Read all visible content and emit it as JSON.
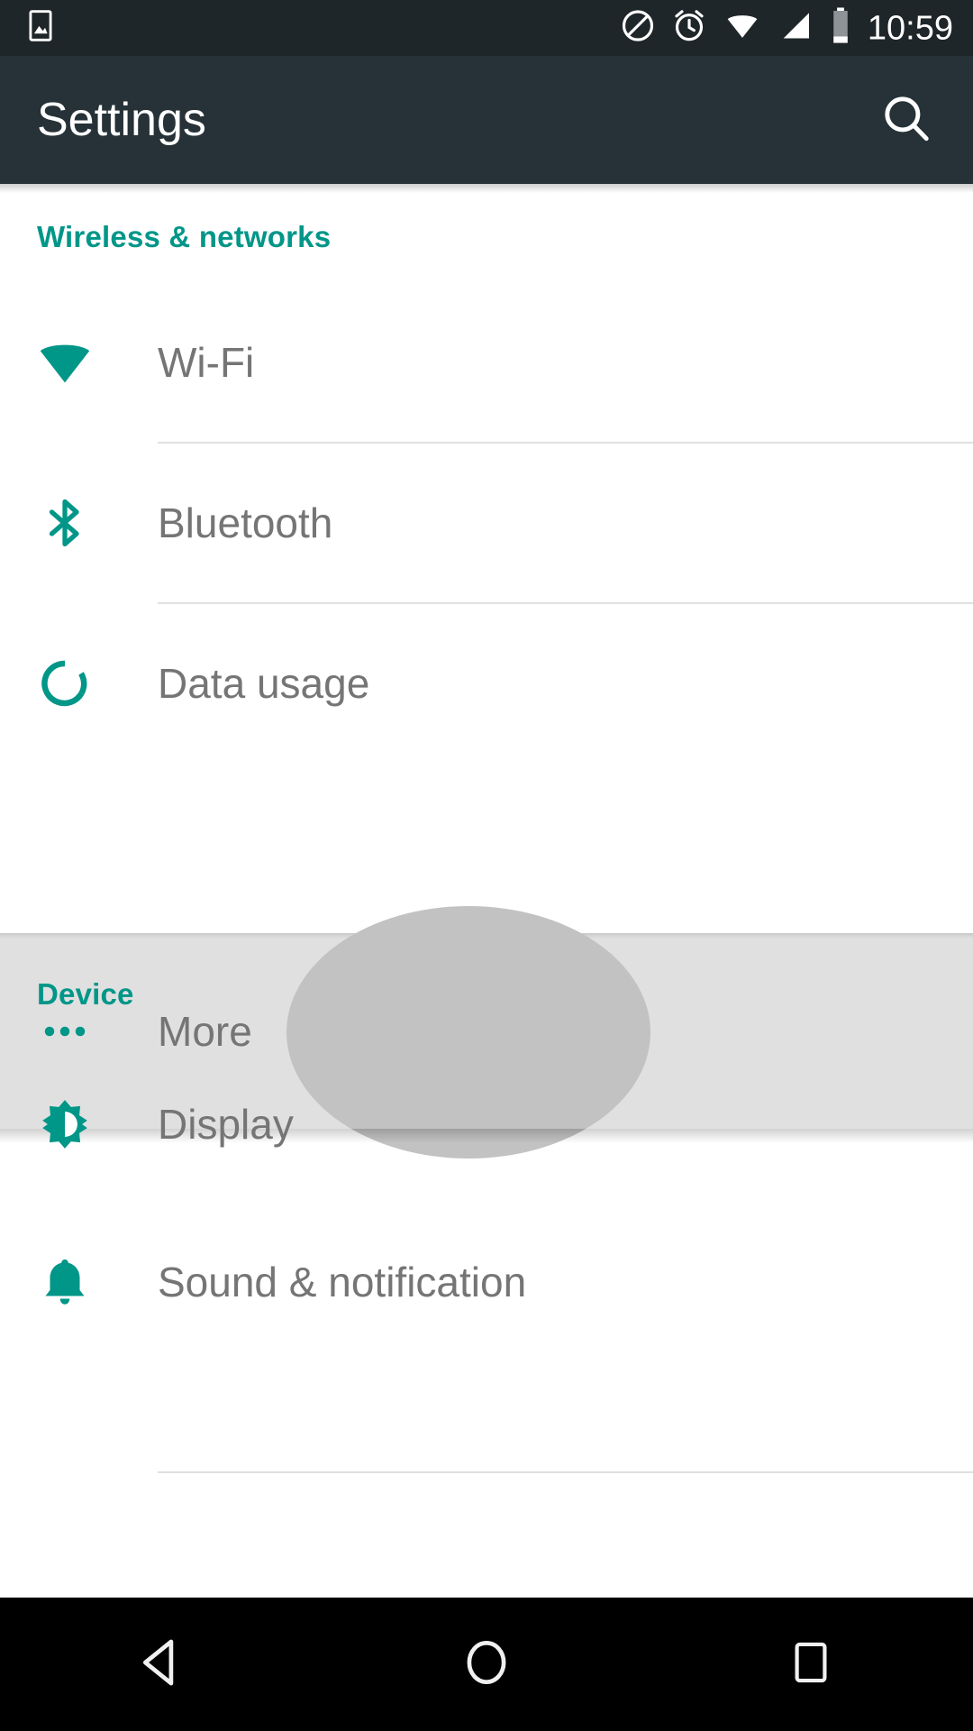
{
  "status_bar": {
    "time": "10:59",
    "icons": {
      "screenshot": "image-icon",
      "dnd": "do-not-disturb-icon",
      "alarm": "alarm-icon",
      "wifi": "wifi-status-icon",
      "signal": "cell-signal-icon",
      "battery": "battery-icon"
    }
  },
  "app_bar": {
    "title": "Settings",
    "search_icon": "search-icon",
    "background_color": "#263238"
  },
  "theme": {
    "accent": "#009688",
    "label_text": "#757575",
    "divider": "#e0e0e0",
    "pressed_background": "#e0e0e0",
    "ripple": "#c2c2c2"
  },
  "sections": [
    {
      "title": "Wireless & networks",
      "items": [
        {
          "label": "Wi-Fi",
          "icon": "wifi-icon",
          "pressed": false
        },
        {
          "label": "Bluetooth",
          "icon": "bluetooth-icon",
          "pressed": false
        },
        {
          "label": "Data usage",
          "icon": "data-usage-icon",
          "pressed": false
        },
        {
          "label": "More",
          "icon": "more-horizontal-icon",
          "pressed": true
        }
      ]
    },
    {
      "title": "Device",
      "items": [
        {
          "label": "Display",
          "icon": "brightness-icon",
          "pressed": false
        },
        {
          "label": "Sound & notification",
          "icon": "bell-icon",
          "pressed": false
        }
      ]
    }
  ],
  "nav_bar": {
    "back": "back-triangle-icon",
    "home": "home-circle-icon",
    "recents": "recents-square-icon"
  }
}
